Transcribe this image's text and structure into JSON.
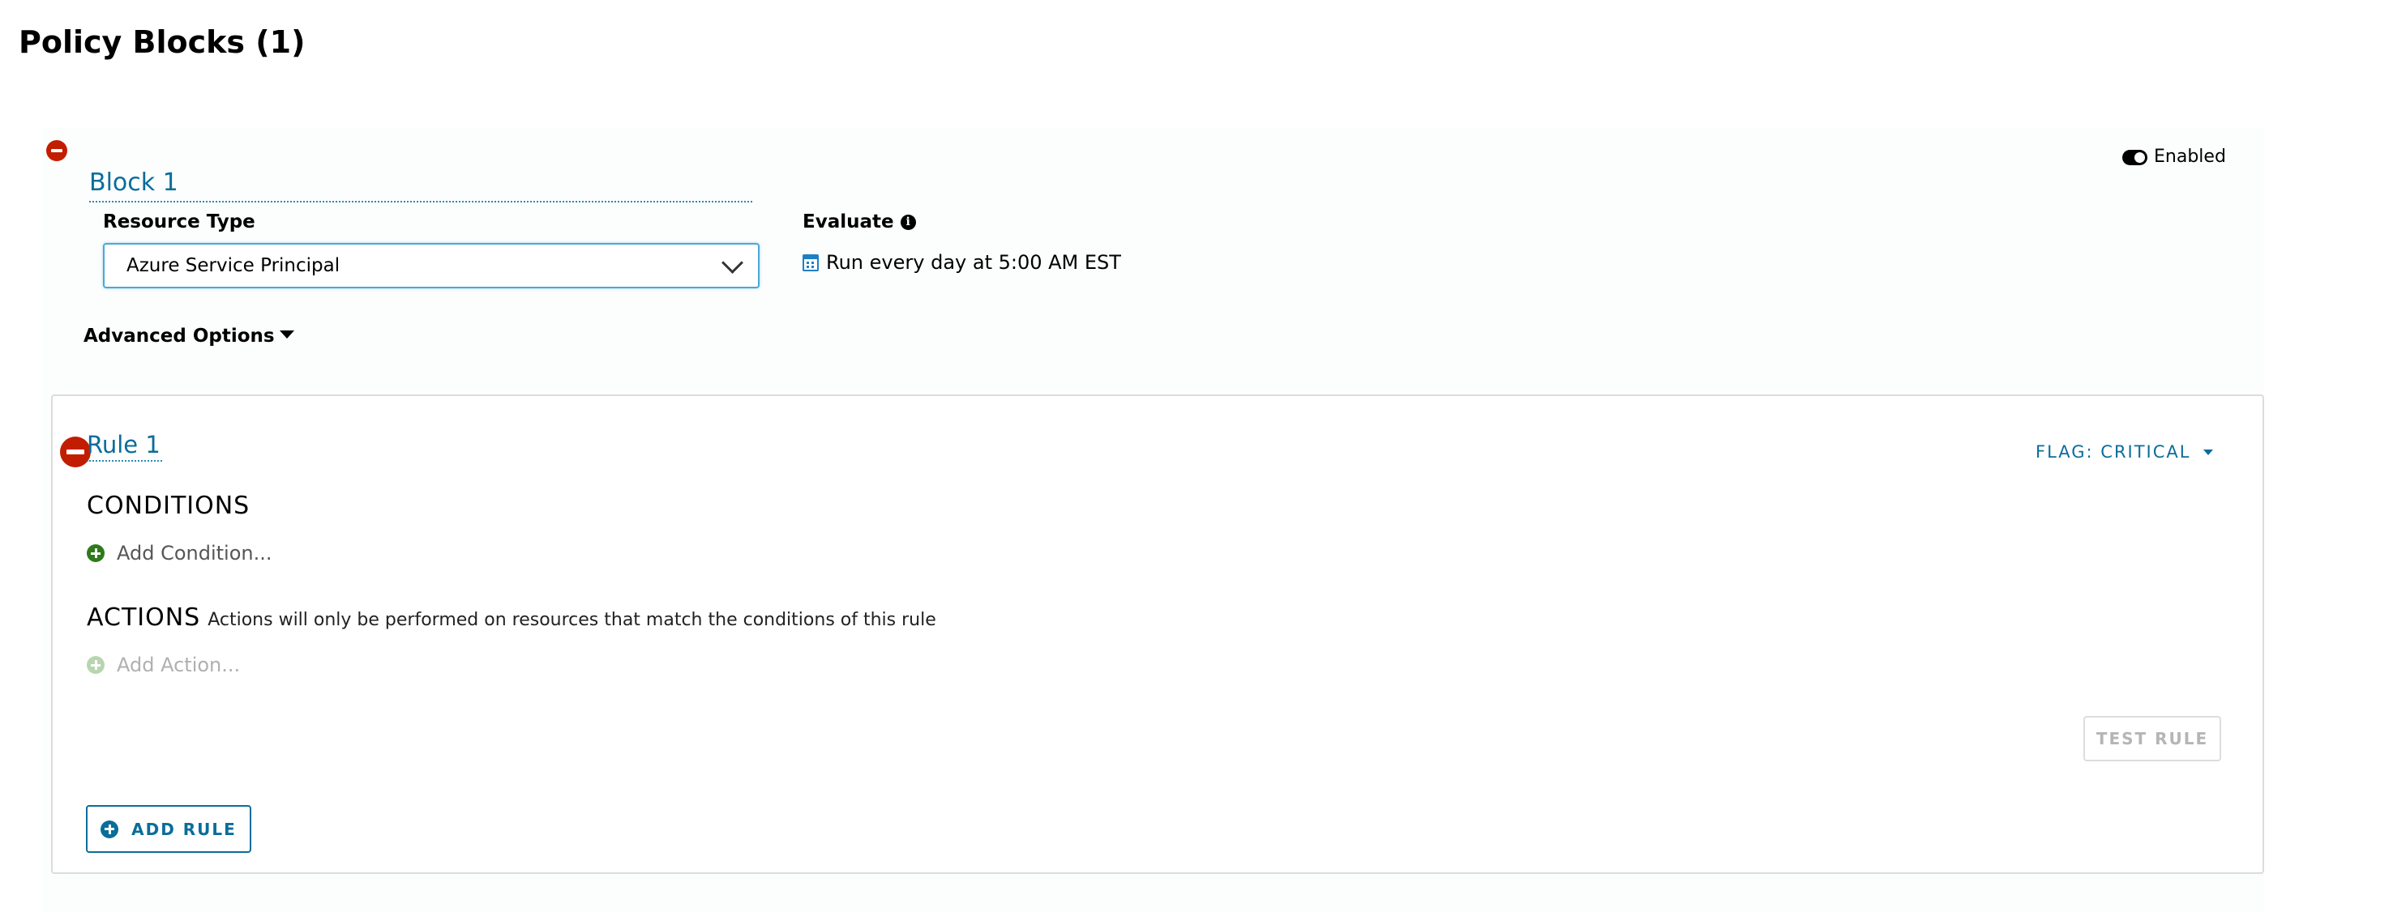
{
  "page": {
    "title": "Policy Blocks (1)"
  },
  "block": {
    "title": "Block 1",
    "enabled_label": "Enabled",
    "resource_type_label": "Resource Type",
    "resource_type_value": "Azure Service Principal",
    "evaluate_label": "Evaluate",
    "schedule_text": "Run every day at 5:00 AM EST",
    "advanced_options_label": "Advanced Options"
  },
  "rule": {
    "title": "Rule 1",
    "flag_label": "FLAG: CRITICAL",
    "conditions_heading": "CONDITIONS",
    "add_condition_label": "Add Condition...",
    "actions_heading": "ACTIONS",
    "actions_note": "Actions will only be performed on resources that match the conditions of this rule",
    "add_action_label": "Add Action...",
    "test_rule_label": "TEST RULE"
  },
  "add_rule_label": "ADD RULE",
  "icons": {
    "block_remove": "minus-circle-icon",
    "toggle": "toggle-on-icon",
    "info": "info-circle-icon",
    "chevron": "chevron-down-icon",
    "calendar": "calendar-icon",
    "caret": "caret-down-icon",
    "add": "plus-circle-icon"
  },
  "colors": {
    "link_blue": "#0a6d9a",
    "remove_red": "#c21d00",
    "add_green": "#2f7a1c",
    "select_border": "#49a9d8"
  }
}
